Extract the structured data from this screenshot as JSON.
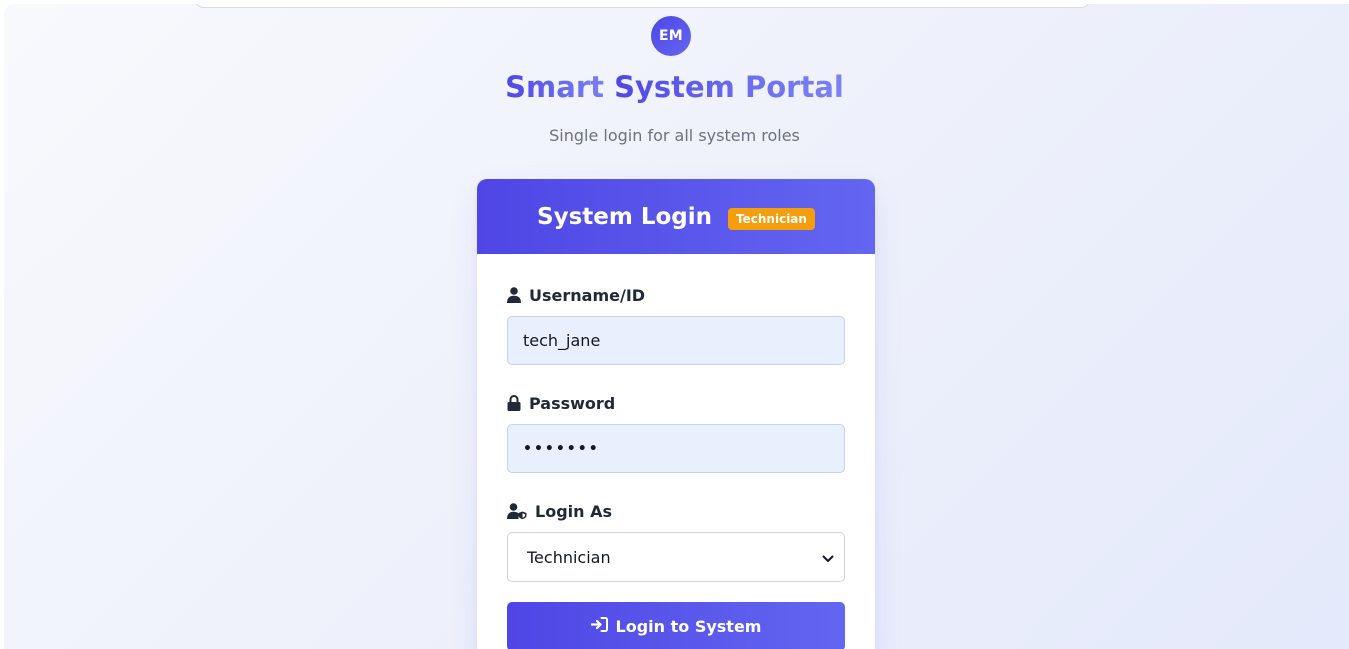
{
  "logo": {
    "initials": "EM"
  },
  "header": {
    "title_part1": "Smart ",
    "title_part2": "System Portal",
    "subtitle": "Single login for all system roles"
  },
  "card": {
    "title": "System Login",
    "role_badge": "Technician"
  },
  "form": {
    "username": {
      "label": "Username/ID",
      "value": "tech_jane",
      "icon": "user-icon"
    },
    "password": {
      "label": "Password",
      "value": "•••••••",
      "icon": "lock-icon"
    },
    "login_as": {
      "label": "Login As",
      "selected": "Technician",
      "icon": "user-shield-icon"
    },
    "submit_label": "Login to System",
    "submit_icon": "sign-in-icon"
  },
  "colors": {
    "primary": "#4f46e5",
    "primary_light": "#6366f1",
    "badge": "#f59e0b",
    "input_bg": "#e8f0fe"
  }
}
